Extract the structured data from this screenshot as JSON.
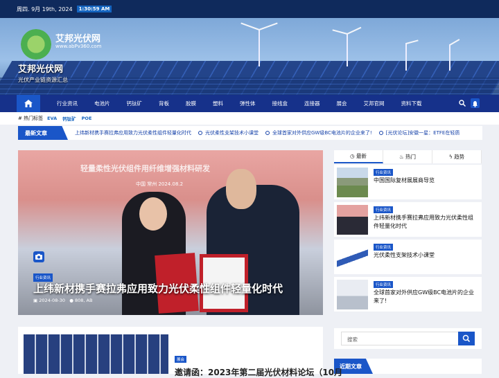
{
  "topbar": {
    "date": "周四. 9月 19th, 2024",
    "time": "1:30:59 AM"
  },
  "header": {
    "logo_text": "艾邦光伏网",
    "logo_sub": "www.abPv360.com",
    "site_name": "艾邦光伏网",
    "tagline": "光伏产业链资源汇总"
  },
  "nav": {
    "items": [
      "行业资讯",
      "电池片",
      "钙钛矿",
      "背板",
      "胶膜",
      "塑料",
      "弹性体",
      "接线盒",
      "连接器",
      "展会",
      "艾邦官网",
      "资料下载"
    ]
  },
  "tags": {
    "label": "热门标签",
    "items": [
      "EVA",
      "钙钛矿",
      "POE"
    ]
  },
  "ticker": {
    "label": "最新文章",
    "items": [
      "上纬新材携手赛拉弗应用致力光伏柔性组件轻量化时代",
      "光伏柔性支架技术小课堂",
      "全球首家对外供应GW级BC电池片的企业来了!",
      "[光伏论坛]安徽一星：ETFE在轻质"
    ]
  },
  "featured": {
    "banner_text": "轻量柔性光伏组件用纤维增强材料研发",
    "location": "中国 常州 2024.08.2",
    "category": "行业资讯",
    "title": "上纬新材携手赛拉弗应用致力光伏柔性组件轻量化时代",
    "date": "2024-08-30",
    "author": "808, AB"
  },
  "sidebar": {
    "tabs": [
      "最新",
      "热门",
      "趋势"
    ],
    "items": [
      {
        "category": "行业资讯",
        "title": "中国国际复材展展商导览"
      },
      {
        "category": "行业资讯",
        "title": "上纬新材携手赛拉弗应用致力光伏柔性组件轻量化时代"
      },
      {
        "category": "行业资讯",
        "title": "光伏柔性支架技术小课堂"
      },
      {
        "category": "行业资讯",
        "title": "全球首家对外供应GW级BC电池片的企业来了!"
      }
    ],
    "search_placeholder": "搜索",
    "recent_label": "近期文章"
  },
  "post2": {
    "category": "展会",
    "title": "邀请函：2023年第二届光伏材料论坛（10月"
  },
  "colors": {
    "primary": "#1a56c8",
    "nav": "#16318a",
    "topbar": "#0f2a5c"
  }
}
